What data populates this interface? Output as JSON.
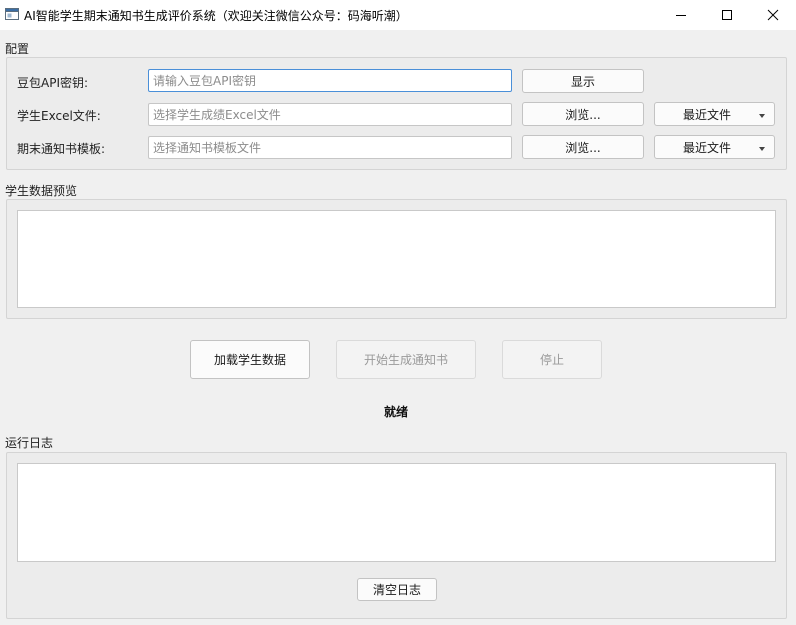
{
  "window": {
    "title": "AI智能学生期末通知书生成评价系统（欢迎关注微信公众号：码海听潮）"
  },
  "config": {
    "group_title": "配置",
    "api_key_label": "豆包API密钥:",
    "api_key_placeholder": "请输入豆包API密钥",
    "show_button": "显示",
    "excel_label": "学生Excel文件:",
    "excel_placeholder": "选择学生成绩Excel文件",
    "template_label": "期末通知书模板:",
    "template_placeholder": "选择通知书模板文件",
    "browse_button": "浏览...",
    "recent_files": "最近文件"
  },
  "preview": {
    "group_title": "学生数据预览"
  },
  "actions": {
    "load_button": "加载学生数据",
    "start_button": "开始生成通知书",
    "stop_button": "停止"
  },
  "status": {
    "text": "就绪"
  },
  "log": {
    "group_title": "运行日志",
    "clear_button": "清空日志"
  }
}
